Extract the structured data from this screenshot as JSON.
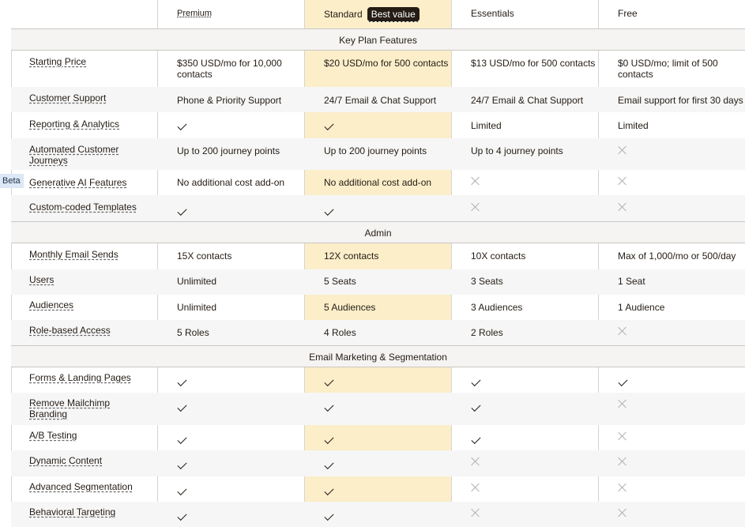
{
  "header": {
    "premium": "Premium",
    "standard": "Standard",
    "best_value": "Best value",
    "essentials": "Essentials",
    "free": "Free"
  },
  "sections": {
    "key": "Key Plan Features",
    "admin": "Admin",
    "email": "Email Marketing & Segmentation"
  },
  "beta": "Beta",
  "rows": {
    "starting_price": {
      "label": "Starting Price",
      "premium": "$350 USD/mo for 10,000 contacts",
      "standard": "$20 USD/mo for 500 contacts",
      "essentials": "$13 USD/mo for 500 contacts",
      "free": "$0 USD/mo; limit of 500 contacts"
    },
    "support": {
      "label": "Customer Support",
      "premium": "Phone & Priority Support",
      "standard": "24/7 Email & Chat Support",
      "essentials": "24/7 Email & Chat Support",
      "free": "Email support for first 30 days"
    },
    "reporting": {
      "label": "Reporting & Analytics",
      "essentials": "Limited",
      "free": "Limited"
    },
    "journeys": {
      "label": "Automated Customer Journeys",
      "premium": "Up to 200 journey points",
      "standard": "Up to 200 journey points",
      "essentials": "Up to 4 journey points"
    },
    "genai": {
      "label": "Generative AI Features",
      "premium": "No additional cost add-on",
      "standard": "No additional cost add-on"
    },
    "templates": {
      "label": "Custom-coded Templates"
    },
    "sends": {
      "label": "Monthly Email Sends",
      "premium": "15X contacts",
      "standard": "12X contacts",
      "essentials": "10X contacts",
      "free": "Max of 1,000/mo or 500/day"
    },
    "users": {
      "label": "Users",
      "premium": "Unlimited",
      "standard": "5 Seats",
      "essentials": "3 Seats",
      "free": "1 Seat"
    },
    "audiences": {
      "label": "Audiences",
      "premium": "Unlimited",
      "standard": "5 Audiences",
      "essentials": "3 Audiences",
      "free": "1 Audience"
    },
    "roles": {
      "label": "Role-based Access",
      "premium": "5 Roles",
      "standard": "4 Roles",
      "essentials": "2 Roles"
    },
    "forms": {
      "label": "Forms & Landing Pages"
    },
    "branding": {
      "label": "Remove Mailchimp Branding"
    },
    "ab": {
      "label": "A/B Testing"
    },
    "dynamic": {
      "label": "Dynamic Content"
    },
    "segmentation": {
      "label": "Advanced Segmentation"
    },
    "behavioral": {
      "label": "Behavioral Targeting"
    }
  },
  "icons": {
    "check": "checkmark-icon",
    "cross": "cross-icon"
  },
  "colors": {
    "highlight": "#fbeec9",
    "section_bg": "#f5f4f2",
    "badge": "#241c15",
    "beta_bg": "#dce8f5"
  }
}
